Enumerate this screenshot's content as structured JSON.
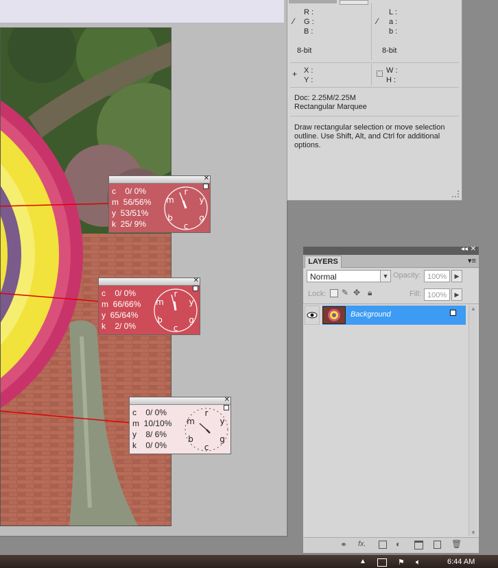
{
  "info_panel": {
    "rgb_labels": [
      "R :",
      "G :",
      "B :"
    ],
    "lab_labels": [
      "L :",
      "a :",
      "b :"
    ],
    "bit_left": "8-bit",
    "bit_right": "8-bit",
    "xy_labels": [
      "X :",
      "Y :"
    ],
    "wh_labels": [
      "W :",
      "H :"
    ],
    "doc_size": "Doc: 2.25M/2.25M",
    "tool_name": "Rectangular Marquee",
    "hint": "Draw rectangular selection or move selection outline.  Use Shift, Alt, and Ctrl for additional options."
  },
  "layers_panel": {
    "tab_label": "LAYERS",
    "blend_mode": "Normal",
    "opacity_label": "Opacity:",
    "opacity_value": "100%",
    "lock_label": "Lock:",
    "fill_label": "Fill:",
    "fill_value": "100%",
    "layer_name": "Background"
  },
  "color_readers": [
    {
      "c": "c    0/ 0%",
      "m": "m  56/56%",
      "y": "y  53/51%",
      "k": "k  25/ 9%",
      "bg": "#c45a62",
      "text": "#ffffff"
    },
    {
      "c": "c    0/ 0%",
      "m": "m  66/66%",
      "y": "y  65/64%",
      "k": "k    2/ 0%",
      "bg": "#cd4c58",
      "text": "#ffffff"
    },
    {
      "c": "c    0/ 0%",
      "m": "m  10/10%",
      "y": "y    8/ 6%",
      "k": "k    0/ 0%",
      "bg": "#f6e3e6",
      "text": "#222222"
    }
  ],
  "dial_letters": [
    "r",
    "y",
    "g",
    "c",
    "b",
    "m"
  ],
  "taskbar": {
    "clock": "6:44 AM"
  },
  "colors": {
    "selection_blue": "#3d9bf3",
    "panel_gray": "#d6d6d6",
    "pointer_line": "#e00000"
  }
}
